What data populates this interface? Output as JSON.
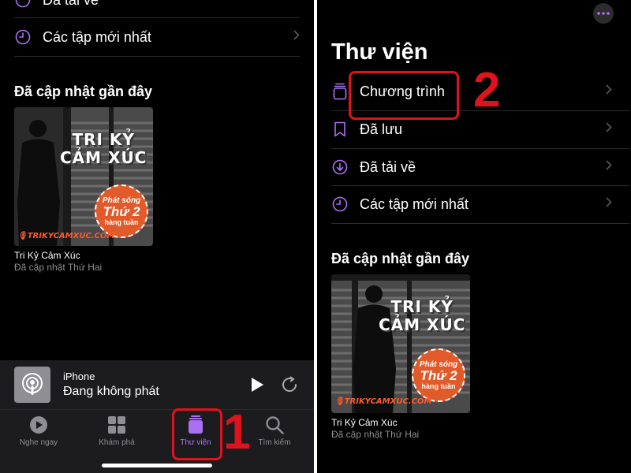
{
  "left": {
    "partial_row_label": "Đã tải về",
    "rows": [
      {
        "label": "Các tập mới nhất",
        "icon": "clock-icon"
      }
    ],
    "section_title": "Đã cập nhật gần đây",
    "podcast": {
      "art_title_line1": "TRI KỶ",
      "art_title_line2": "CẢM XÚC",
      "badge_line1": "Phát sóng",
      "badge_line2": "Thứ 2",
      "badge_line3": "hàng tuần",
      "site": "TRIKYCAMXUC.COM",
      "title": "Tri Kỷ Cảm Xúc",
      "subtitle": "Đã cập nhật Thứ Hai"
    },
    "mini_player": {
      "device": "iPhone",
      "status": "Đang không phát"
    },
    "tabs": [
      {
        "label": "Nghe ngay",
        "icon": "play-circle-icon"
      },
      {
        "label": "Khám phá",
        "icon": "grid-icon"
      },
      {
        "label": "Thư viện",
        "icon": "library-icon",
        "active": true
      },
      {
        "label": "Tìm kiếm",
        "icon": "search-icon"
      }
    ],
    "step_label": "1"
  },
  "right": {
    "title": "Thư viện",
    "rows": [
      {
        "label": "Chương trình",
        "icon": "stack-icon"
      },
      {
        "label": "Đã lưu",
        "icon": "bookmark-icon"
      },
      {
        "label": "Đã tải về",
        "icon": "download-icon"
      },
      {
        "label": "Các tập mới nhất",
        "icon": "clock-icon"
      }
    ],
    "section_title": "Đã cập nhật gần đây",
    "podcast": {
      "art_title_line1": "TRI KỶ",
      "art_title_line2": "CẢM XÚC",
      "badge_line1": "Phát sóng",
      "badge_line2": "Thứ 2",
      "badge_line3": "hàng tuần",
      "site": "TRIKYCAMXUC.COM",
      "title": "Tri Kỷ Cảm Xúc",
      "subtitle": "Đã cập nhật Thứ Hai"
    },
    "step_label": "2"
  },
  "colors": {
    "accent": "#a971f2",
    "background": "#000000",
    "bar": "#1c1c1e",
    "highlight": "#e0121b",
    "badge": "#e05a2a"
  }
}
